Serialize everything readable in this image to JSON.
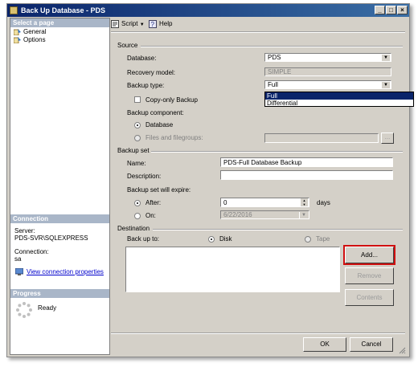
{
  "window": {
    "title": "Back Up Database - PDS",
    "controls": [
      "_",
      "□",
      "×"
    ]
  },
  "left_pane": {
    "select_page_header": "Select a page",
    "pages": [
      {
        "label": "General",
        "icon": "page-icon"
      },
      {
        "label": "Options",
        "icon": "page-icon"
      }
    ],
    "connection_header": "Connection",
    "server_label": "Server:",
    "server_value": "PDS-SVR\\SQLEXPRESS",
    "connection_label": "Connection:",
    "connection_value": "sa",
    "view_connection_properties": "View connection properties",
    "progress_header": "Progress",
    "progress_status": "Ready"
  },
  "toolbar": {
    "script_label": "Script",
    "help_label": "Help"
  },
  "source": {
    "section_label": "Source",
    "database_label": "Database:",
    "database_value": "PDS",
    "recovery_model_label": "Recovery model:",
    "recovery_model_value": "SIMPLE",
    "backup_type_label": "Backup type:",
    "backup_type_value": "Full",
    "backup_type_options": [
      "Full",
      "Differential"
    ],
    "backup_type_selected_index": 0,
    "copy_only_label": "Copy-only Backup",
    "copy_only_checked": false,
    "backup_component_label": "Backup component:",
    "component_database_label": "Database",
    "component_files_label": "Files and filegroups:",
    "component_selected": "Database",
    "files_browse_label": "..."
  },
  "backup_set": {
    "section_label": "Backup set",
    "name_label": "Name:",
    "name_value": "PDS-Full Database Backup",
    "description_label": "Description:",
    "description_value": "",
    "expire_label": "Backup set will expire:",
    "after_label": "After:",
    "after_value": "0",
    "after_unit": "days",
    "on_label": "On:",
    "on_value": "6/22/2016",
    "expire_selected": "After"
  },
  "destination": {
    "section_label": "Destination",
    "back_up_to_label": "Back up to:",
    "disk_label": "Disk",
    "tape_label": "Tape",
    "selected": "Disk",
    "list_items": [],
    "add_button": "Add...",
    "remove_button": "Remove",
    "contents_button": "Contents"
  },
  "footer": {
    "ok_button": "OK",
    "cancel_button": "Cancel"
  },
  "colors": {
    "title_gradient_start": "#0a246a",
    "title_gradient_end": "#3a6ea5",
    "highlight_box": "#d01010",
    "selection": "#0a246a"
  }
}
